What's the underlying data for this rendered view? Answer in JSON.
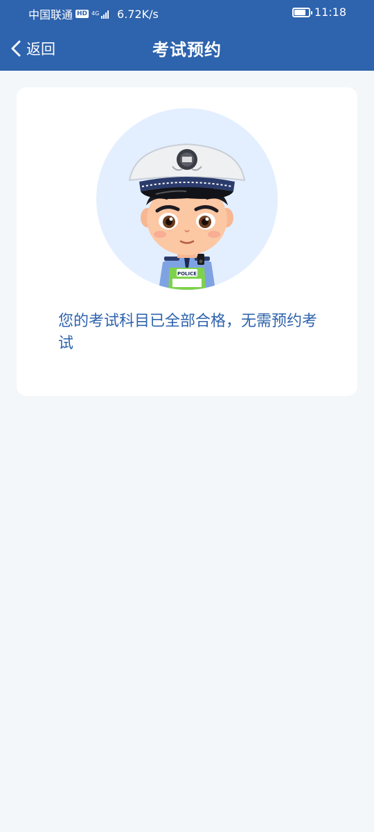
{
  "status_bar": {
    "carrier": "中国联通",
    "hd_badge": "HD",
    "network": "4G",
    "speed": "6.72K/s",
    "time": "11:18"
  },
  "nav": {
    "back_label": "返回",
    "title": "考试预约"
  },
  "card": {
    "illustration": "traffic-police-officer",
    "badge_text": "POLICE",
    "message": "您的考试科目已全部合格，无需预约考试"
  },
  "colors": {
    "header_bg": "#2e63ad",
    "page_bg": "#f3f7f9",
    "accent_text": "#2e63ad",
    "avatar_bg": "#e3efff"
  }
}
